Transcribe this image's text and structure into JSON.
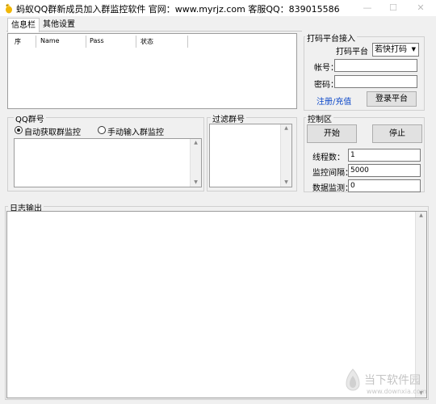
{
  "window": {
    "title": "蚂蚁QQ群新成员加入群监控软件  官网：www.myrjz.com  客服QQ：839015586",
    "minimize_glyph": "—",
    "maximize_glyph": "☐",
    "close_glyph": "✕"
  },
  "tabs": [
    {
      "label": "信息栏"
    },
    {
      "label": "其他设置"
    }
  ],
  "info_table": {
    "columns": [
      "序",
      "Name",
      "Pass",
      "状态"
    ]
  },
  "coding_platform": {
    "title": "打码平台接入",
    "platform_label": "打码平台",
    "platform_value": "若快打码",
    "account_label": "帐号：",
    "account_value": "",
    "password_label": "密码：",
    "password_value": "",
    "register_link": "注册/充值",
    "login_button": "登录平台"
  },
  "qq_group": {
    "title": "QQ群号",
    "auto_option": "自动获取群监控",
    "manual_option": "手动输入群监控",
    "selected": "auto"
  },
  "filter_group": {
    "title": "过滤群号"
  },
  "control": {
    "title": "控制区",
    "start_button": "开始",
    "stop_button": "停止",
    "threads_label": "线程数：",
    "threads_value": "1",
    "interval_label": "监控间隔：",
    "interval_value": "5000",
    "count_label": "数据监测：",
    "count_value": "0"
  },
  "log": {
    "title": "日志输出"
  },
  "watermark": {
    "text": "当下软件园",
    "domain": "www.downxia.com"
  }
}
